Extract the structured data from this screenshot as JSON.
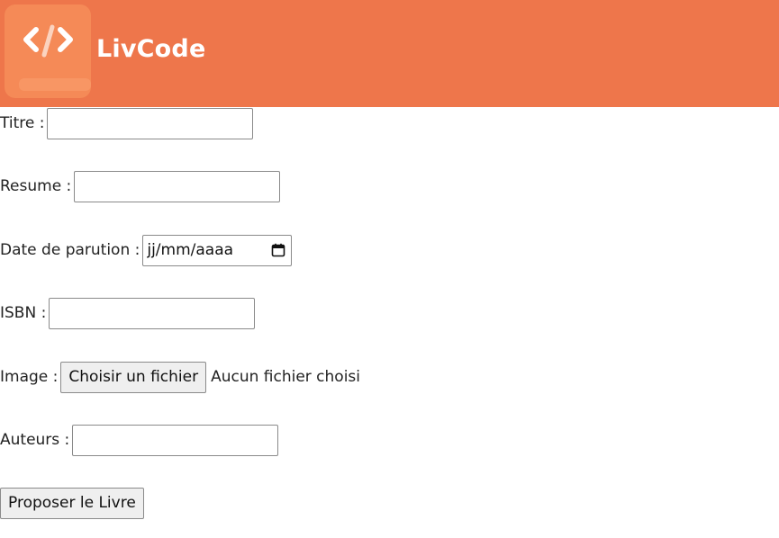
{
  "header": {
    "brand": "LivCode",
    "color": "#ee764b",
    "logo_icon": "code-icon"
  },
  "form": {
    "titre": {
      "label": "Titre :",
      "value": ""
    },
    "resume": {
      "label": "Resume :",
      "value": ""
    },
    "date": {
      "label": "Date de parution :",
      "placeholder": "jj/mm/aaaa",
      "icon": "calendar-icon"
    },
    "isbn": {
      "label": "ISBN :",
      "value": ""
    },
    "image": {
      "label": "Image :",
      "button": "Choisir un fichier",
      "status": "Aucun fichier choisi"
    },
    "auteurs": {
      "label": "Auteurs :",
      "value": ""
    },
    "submit": {
      "label": "Proposer le Livre"
    }
  }
}
